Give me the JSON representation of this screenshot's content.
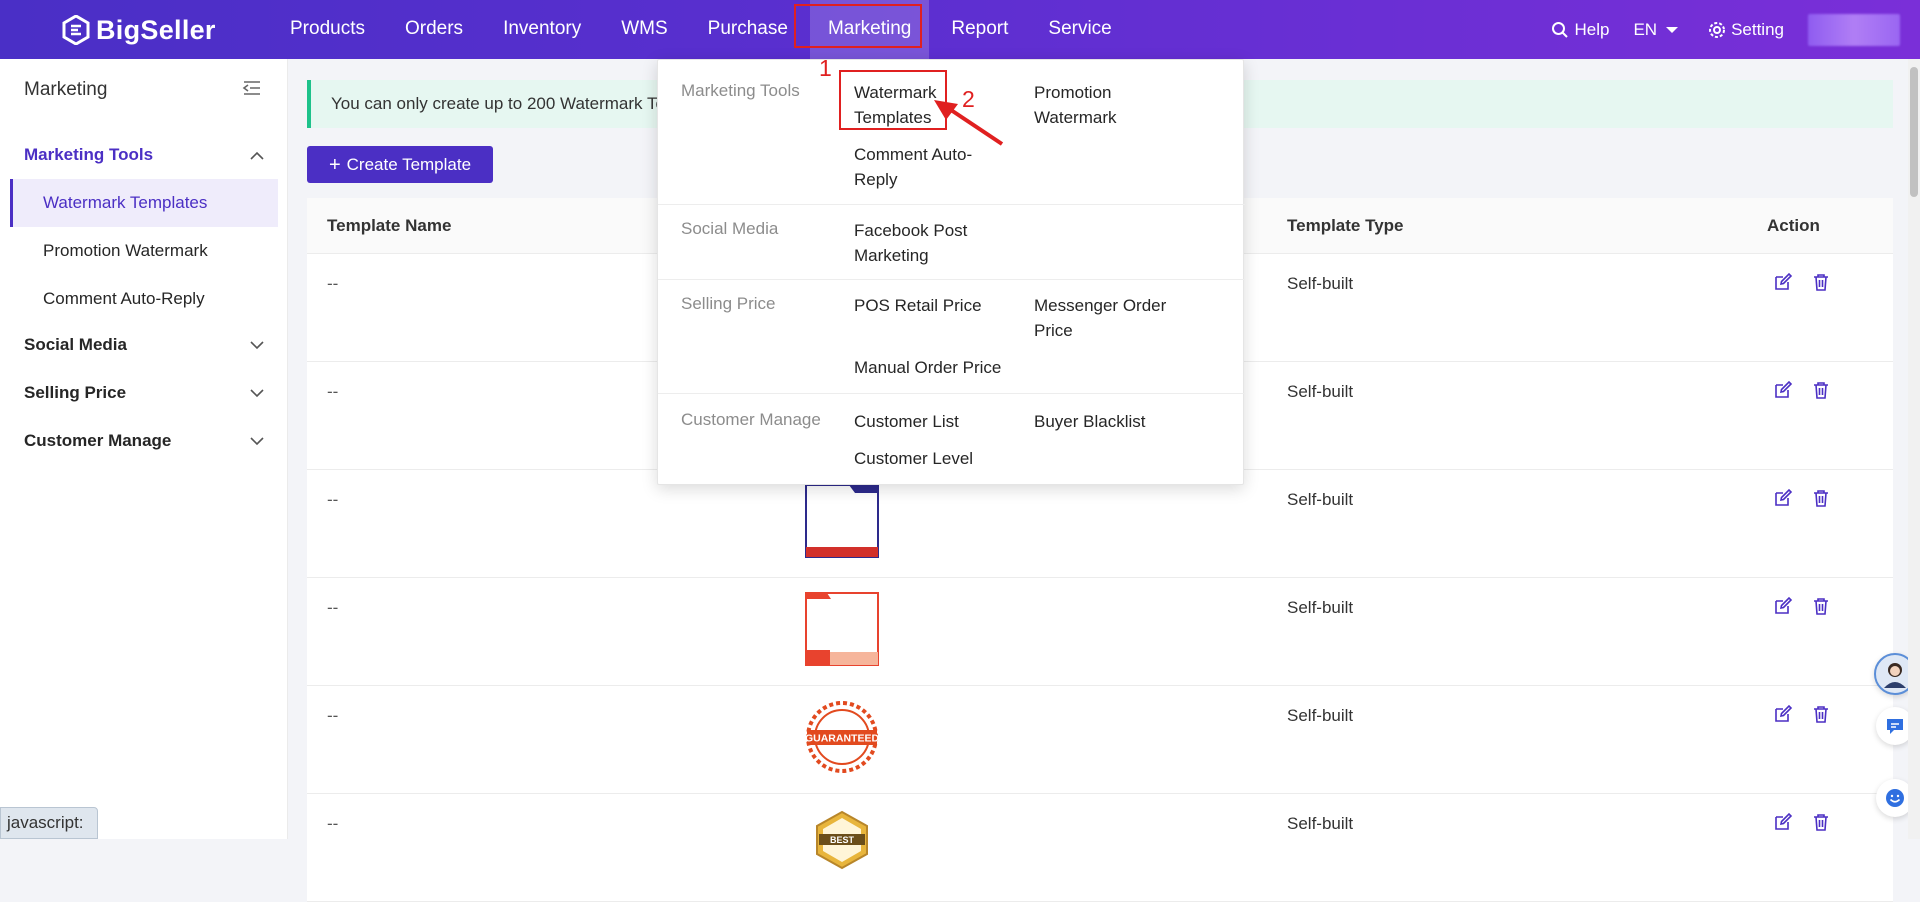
{
  "brand": {
    "name": "BigSeller"
  },
  "nav": {
    "items": [
      "Products",
      "Orders",
      "Inventory",
      "WMS",
      "Purchase",
      "Marketing",
      "Report",
      "Service"
    ],
    "active": "Marketing",
    "help": "Help",
    "lang": "EN",
    "setting": "Setting"
  },
  "sidebar": {
    "title": "Marketing",
    "groups": [
      {
        "label": "Marketing Tools",
        "expanded": true,
        "items": [
          "Watermark Templates",
          "Promotion Watermark",
          "Comment Auto-Reply"
        ]
      },
      {
        "label": "Social Media",
        "expanded": false
      },
      {
        "label": "Selling Price",
        "expanded": false
      },
      {
        "label": "Customer Manage",
        "expanded": false
      }
    ],
    "active_item": "Watermark Templates"
  },
  "main": {
    "notice": "You can only create up to 200 Watermark Ter",
    "create_button": "Create Template",
    "columns": [
      "Template Name",
      "Template Type",
      "Action"
    ],
    "rows": [
      {
        "name": "--",
        "type": "Self-built"
      },
      {
        "name": "--",
        "type": "Self-built"
      },
      {
        "name": "--",
        "type": "Self-built"
      },
      {
        "name": "--",
        "type": "Self-built"
      },
      {
        "name": "--",
        "type": "Self-built"
      },
      {
        "name": "--",
        "type": "Self-built"
      }
    ],
    "badge_guaranteed": "GUARANTEED",
    "badge_best": "BEST"
  },
  "dropdown": {
    "sections": [
      {
        "category": "Marketing Tools",
        "links": [
          "Watermark Templates",
          "Promotion Watermark",
          "Comment Auto-Reply"
        ]
      },
      {
        "category": "Social Media",
        "links": [
          "Facebook Post Marketing"
        ]
      },
      {
        "category": "Selling Price",
        "links": [
          "POS Retail Price",
          "Messenger Order Price",
          "Manual Order Price"
        ]
      },
      {
        "category": "Customer Manage",
        "links": [
          "Customer List",
          "Buyer Blacklist",
          "Customer Level"
        ]
      }
    ]
  },
  "annotations": {
    "step1": "1",
    "step2": "2"
  },
  "status_tip": "javascript:",
  "colors": {
    "primary": "#4b2fc4",
    "highlight": "#e02020",
    "notice_bg": "#e6f7f1"
  }
}
